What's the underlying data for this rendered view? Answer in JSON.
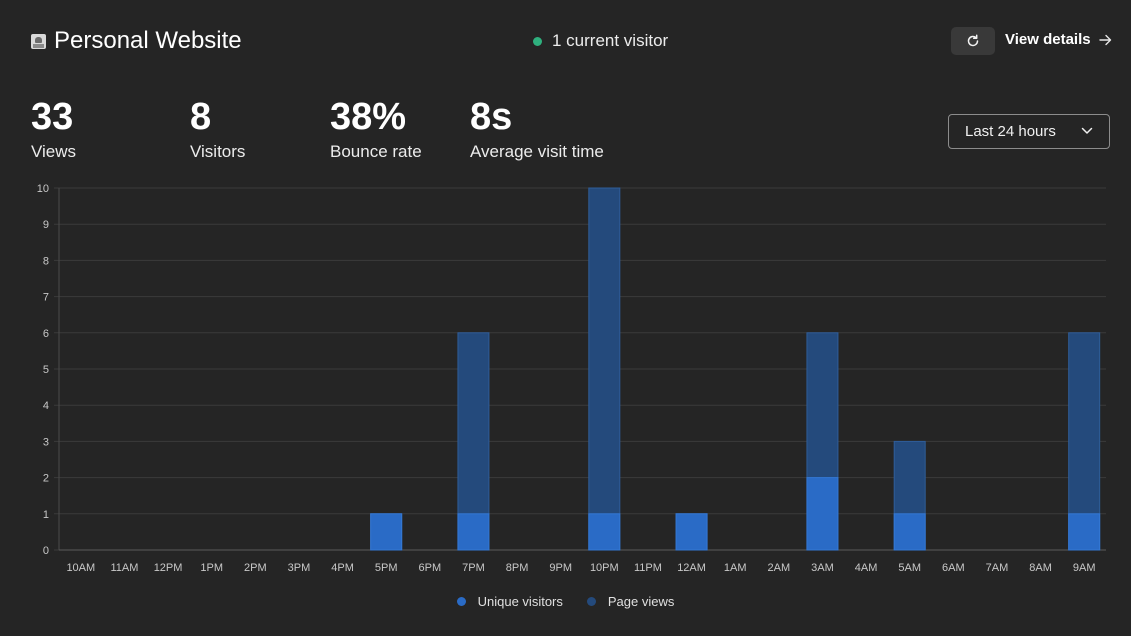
{
  "header": {
    "site_title": "Personal Website",
    "live_text": "1 current visitor",
    "view_details_label": "View details"
  },
  "metrics": [
    {
      "value": "33",
      "label": "Views"
    },
    {
      "value": "8",
      "label": "Visitors"
    },
    {
      "value": "38%",
      "label": "Bounce rate"
    },
    {
      "value": "8s",
      "label": "Average visit time"
    }
  ],
  "range_select": {
    "value": "Last 24 hours"
  },
  "icons": {
    "favicon": "website-favicon-icon",
    "live": "live-dot-icon",
    "refresh": "refresh-icon",
    "arrow": "arrow-right-icon",
    "chevron": "chevron-down-icon"
  },
  "colors": {
    "background": "#252525",
    "live": "#2fb07e",
    "unique_visitors": "#2a6bc6",
    "page_views": "#244a7c"
  },
  "chart_data": {
    "type": "bar",
    "stacked": true,
    "categories": [
      "10AM",
      "11AM",
      "12PM",
      "1PM",
      "2PM",
      "3PM",
      "4PM",
      "5PM",
      "6PM",
      "7PM",
      "8PM",
      "9PM",
      "10PM",
      "11PM",
      "12AM",
      "1AM",
      "2AM",
      "3AM",
      "4AM",
      "5AM",
      "6AM",
      "7AM",
      "8AM",
      "9AM"
    ],
    "series": [
      {
        "name": "Unique visitors",
        "color": "#2a6bc6",
        "values": [
          0,
          0,
          0,
          0,
          0,
          0,
          0,
          1,
          0,
          1,
          0,
          0,
          1,
          0,
          1,
          0,
          0,
          2,
          0,
          1,
          0,
          0,
          0,
          1
        ]
      },
      {
        "name": "Page views",
        "color": "#244a7c",
        "values": [
          0,
          0,
          0,
          0,
          0,
          0,
          0,
          1,
          0,
          6,
          0,
          0,
          10,
          0,
          1,
          0,
          0,
          6,
          0,
          3,
          0,
          0,
          0,
          6
        ]
      }
    ],
    "ylim": [
      0,
      10
    ],
    "yticks": [
      "0",
      "1",
      "2",
      "3",
      "4",
      "5",
      "6",
      "7",
      "8",
      "9",
      "10"
    ],
    "grid": true,
    "legend": "bottom-center"
  }
}
